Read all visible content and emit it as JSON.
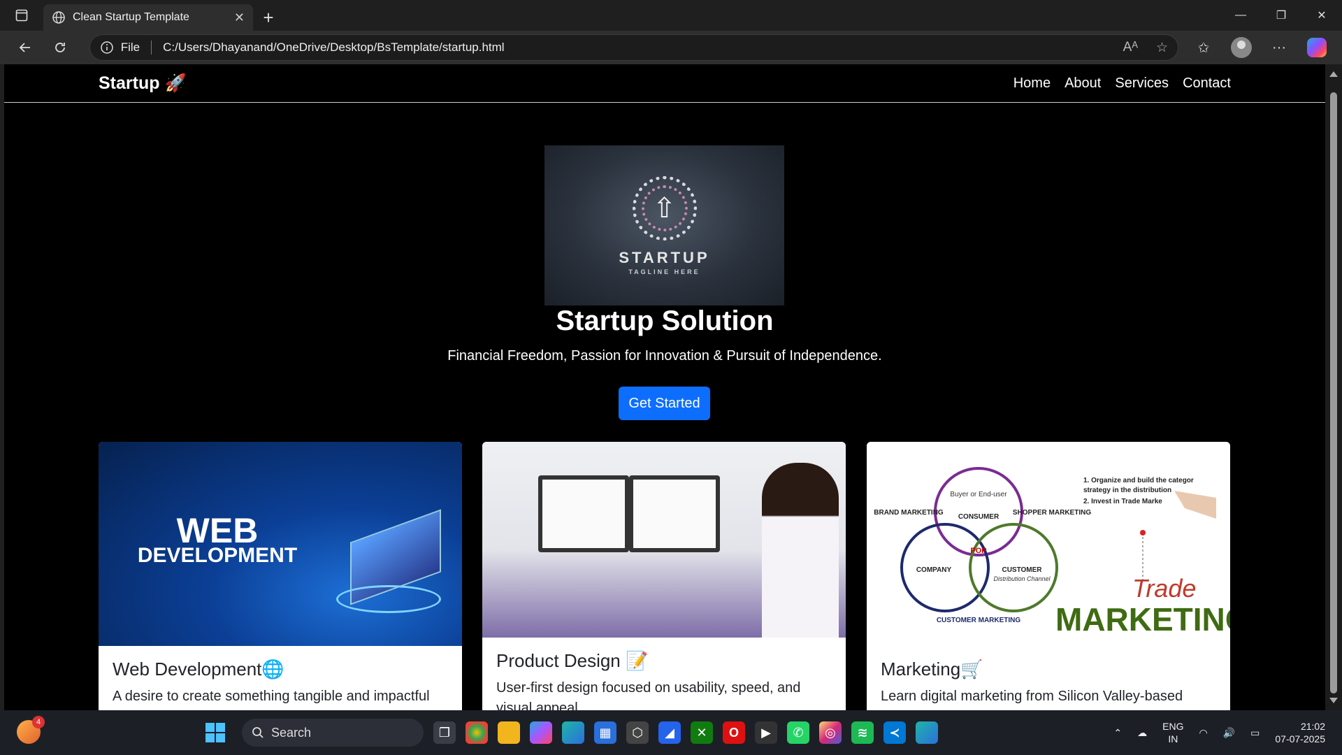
{
  "browser": {
    "tab_title": "Clean Startup Template",
    "scheme_label": "File",
    "url": "C:/Users/Dhayanand/OneDrive/Desktop/BsTemplate/startup.html"
  },
  "page": {
    "brand": "Startup 🚀",
    "nav": [
      "Home",
      "About",
      "Services",
      "Contact"
    ],
    "hero": {
      "logo_word": "STARTUP",
      "logo_tagline": "TAGLINE HERE",
      "title": "Startup Solution",
      "subtitle": "Financial Freedom, Passion for Innovation & Pursuit of Independence.",
      "cta": "Get Started"
    },
    "cards": [
      {
        "title": "Web Development🌐",
        "desc": "A desire to create something tangible and impactful",
        "image_text": [
          "WEB",
          "DEVELOPMENT"
        ]
      },
      {
        "title": "Product Design 📝",
        "desc": "User-first design focused on usability, speed, and visual appeal."
      },
      {
        "title": "Marketing🛒",
        "desc": "Learn digital marketing from Silicon Valley-based",
        "image_text": {
          "brand": "BRAND MARKETING",
          "buyer": "Buyer or End-user",
          "consumer": "CONSUMER",
          "shopper": "SHOPPER MARKETING",
          "company": "COMPANY",
          "pop": "POP",
          "customer": "CUSTOMER",
          "channel": "Distribution Channel",
          "customer_marketing": "CUSTOMER MARKETING",
          "list1": "1. Organize and build the categor",
          "list1b": "strategy in the distribution",
          "list2": "2. Invest in Trade Marke",
          "trade": "Trade",
          "marketing": "MARKETING"
        }
      }
    ]
  },
  "taskbar": {
    "search_placeholder": "Search",
    "notification_count": "4",
    "lang_top": "ENG",
    "lang_bottom": "IN",
    "time": "21:02",
    "date": "07-07-2025"
  },
  "colors": {
    "primary_button": "#0d6efd",
    "page_bg": "#000000",
    "chrome_bg": "#1f1f1f"
  }
}
